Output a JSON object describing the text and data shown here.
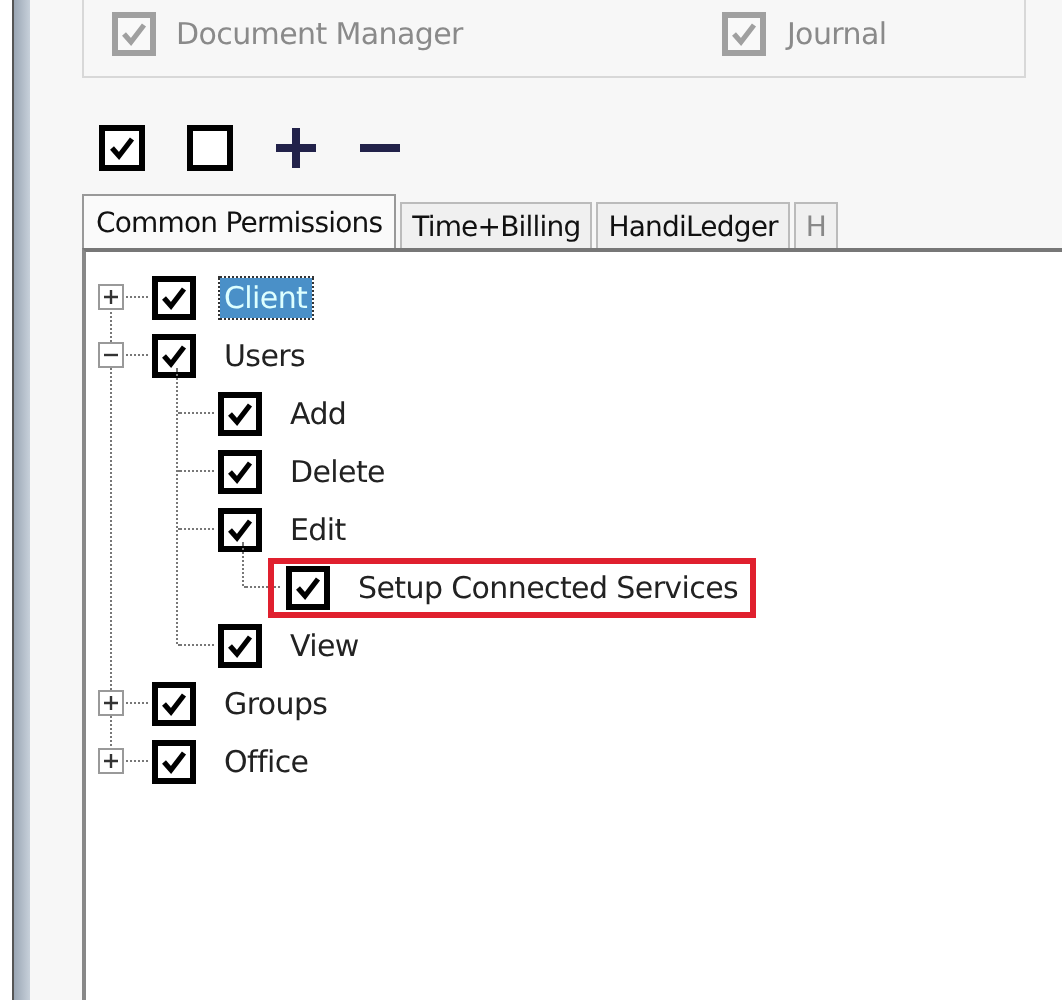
{
  "top_options": [
    {
      "label": "Document Manager",
      "checked": true
    },
    {
      "label": "Journal",
      "checked": true
    }
  ],
  "toolbar": [
    {
      "kind": "check-all"
    },
    {
      "kind": "uncheck-all"
    },
    {
      "kind": "expand"
    },
    {
      "kind": "collapse"
    }
  ],
  "tabs": [
    {
      "label": "Common Permissions",
      "selected": true
    },
    {
      "label": "Time+Billing",
      "selected": false
    },
    {
      "label": "HandiLedger",
      "selected": false
    },
    {
      "label": "H",
      "selected": false
    }
  ],
  "tree": [
    {
      "label": "Client",
      "checked": true,
      "selected": true,
      "expandable": true,
      "expanded": false
    },
    {
      "label": "Users",
      "checked": true,
      "selected": false,
      "expandable": true,
      "expanded": true,
      "children": [
        {
          "label": "Add",
          "checked": true,
          "selected": false
        },
        {
          "label": "Delete",
          "checked": true,
          "selected": false
        },
        {
          "label": "Edit",
          "checked": true,
          "selected": false,
          "children": [
            {
              "label": "Setup Connected Services",
              "checked": true,
              "selected": false,
              "highlighted": true
            }
          ]
        },
        {
          "label": "View",
          "checked": true,
          "selected": false
        }
      ]
    },
    {
      "label": "Groups",
      "checked": true,
      "selected": false,
      "expandable": true,
      "expanded": false
    },
    {
      "label": "Office",
      "checked": true,
      "selected": false,
      "expandable": true,
      "expanded": false
    }
  ]
}
